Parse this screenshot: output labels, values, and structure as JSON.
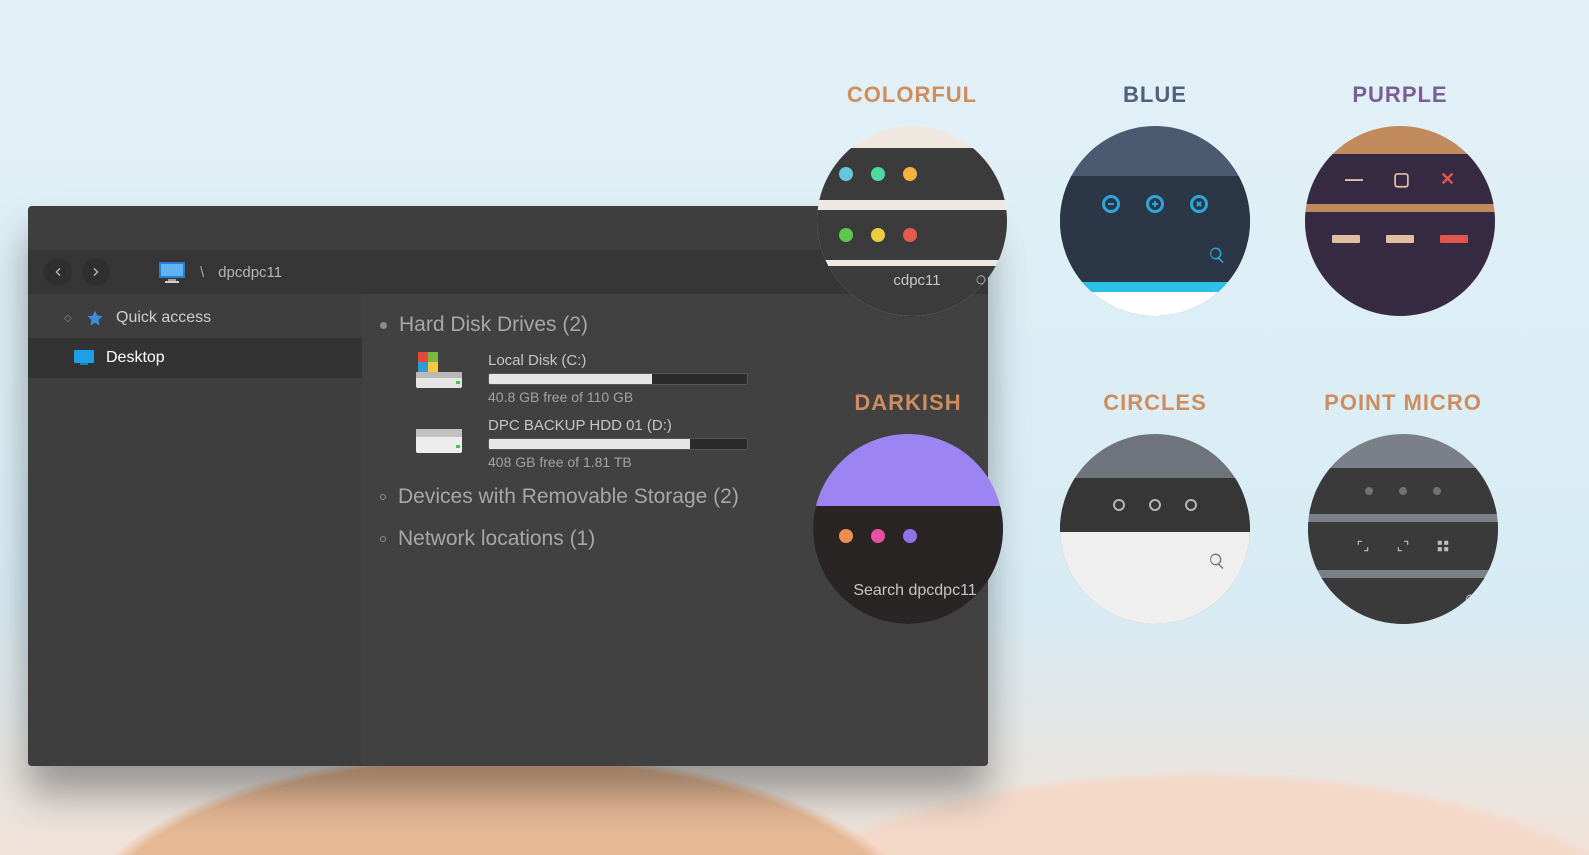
{
  "explorer": {
    "path_location": "dpcdpc11",
    "search_label": "Sear",
    "sidebar": {
      "quick_access": "Quick access",
      "desktop": "Desktop"
    },
    "categories": {
      "hdd": "Hard Disk Drives (2)",
      "removable": "Devices with Removable Storage (2)",
      "network": "Network locations (1)"
    },
    "drives": [
      {
        "name": "Local Disk (C:)",
        "free_text": "40.8 GB free of 110 GB",
        "fill_pct": 63
      },
      {
        "name": "DPC BACKUP HDD 01 (D:)",
        "free_text": "408 GB free of 1.81 TB",
        "fill_pct": 78
      }
    ]
  },
  "themes": {
    "colorful": {
      "label": "COLORFUL",
      "search_snippet": "cdpc11"
    },
    "blue": {
      "label": "BLUE"
    },
    "purple": {
      "label": "PURPLE"
    },
    "darkish": {
      "label": "DARKISH",
      "search_text": "Search dpcdpc11"
    },
    "circles": {
      "label": "CIRCLES"
    },
    "point_micro": {
      "label": "POINT MICRO"
    }
  }
}
